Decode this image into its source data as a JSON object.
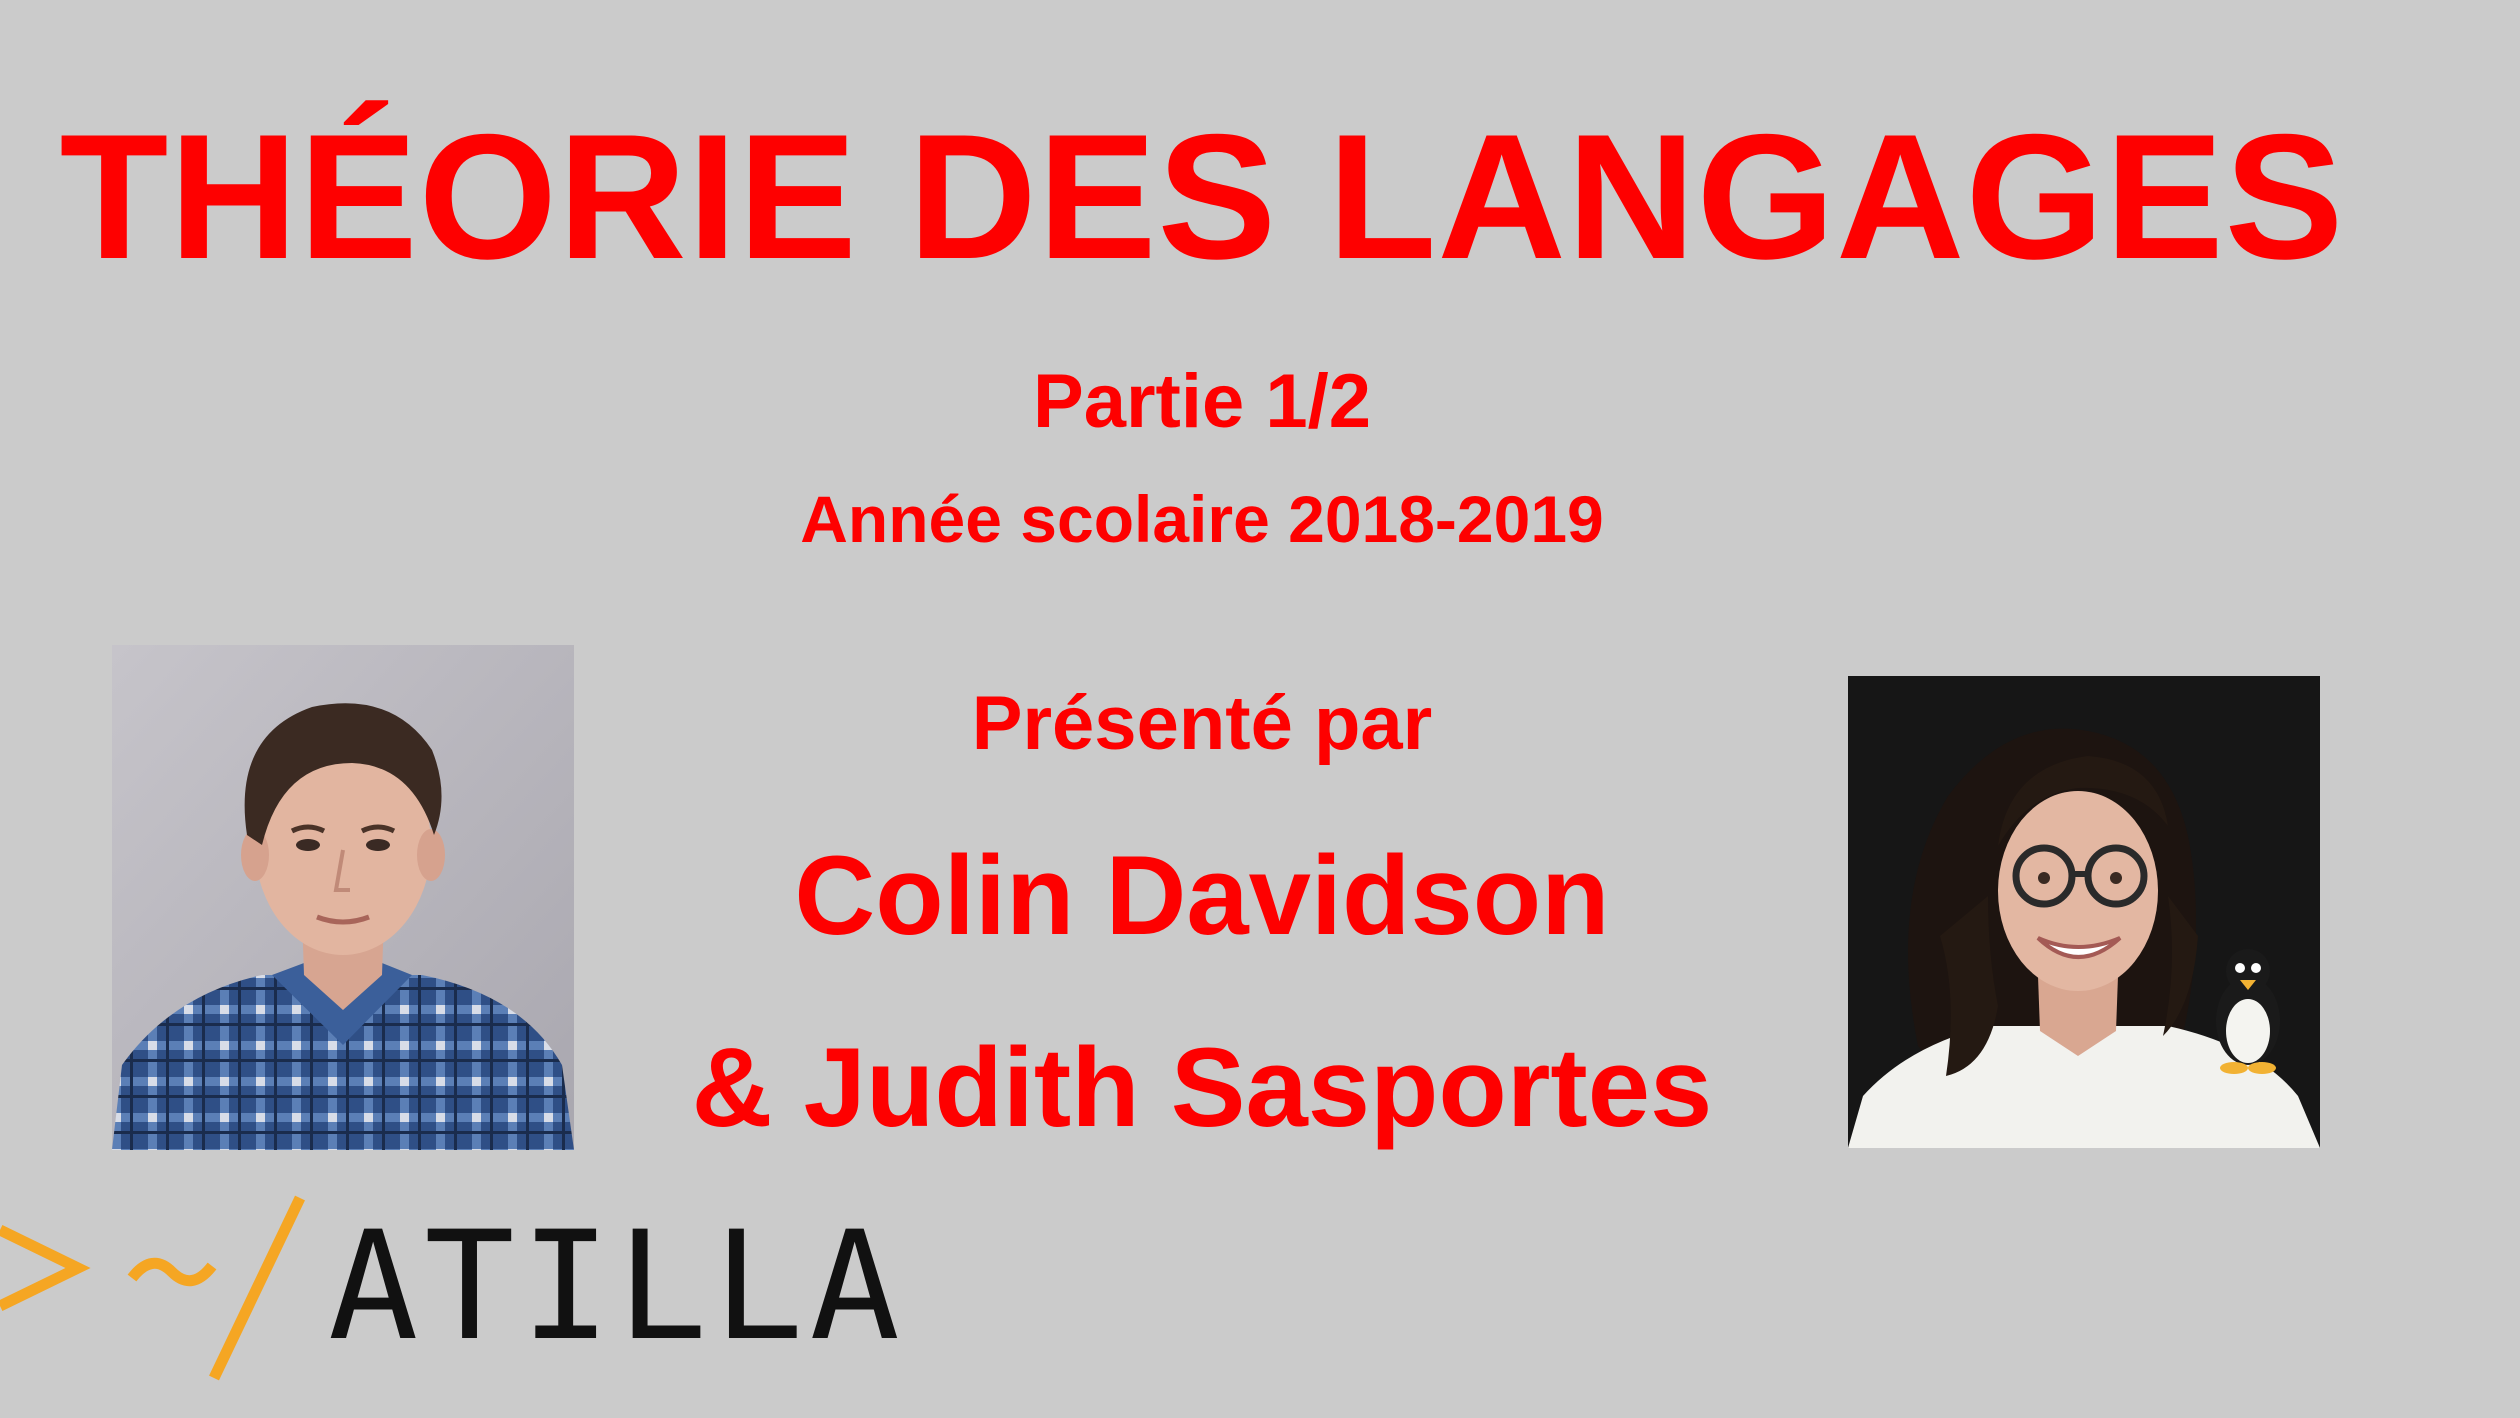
{
  "slide": {
    "title": "THÉORIE DES LANGAGES",
    "part": "Partie 1/2",
    "school_year": "Année scolaire 2018-2019",
    "presented_by": "Présenté par",
    "presenter_1": "Colin Davidson",
    "presenter_2": "& Judith Sasportes"
  },
  "logo": {
    "wordmark": "ATILLA",
    "symbol": ">~/",
    "symbol_color": "#f5a623",
    "text_color": "#111111"
  },
  "colors": {
    "background": "#cbcbcb",
    "accent": "#fe0000"
  },
  "icons": [
    "presenter-photo-left",
    "presenter-photo-right",
    "tux-penguin-icon"
  ]
}
